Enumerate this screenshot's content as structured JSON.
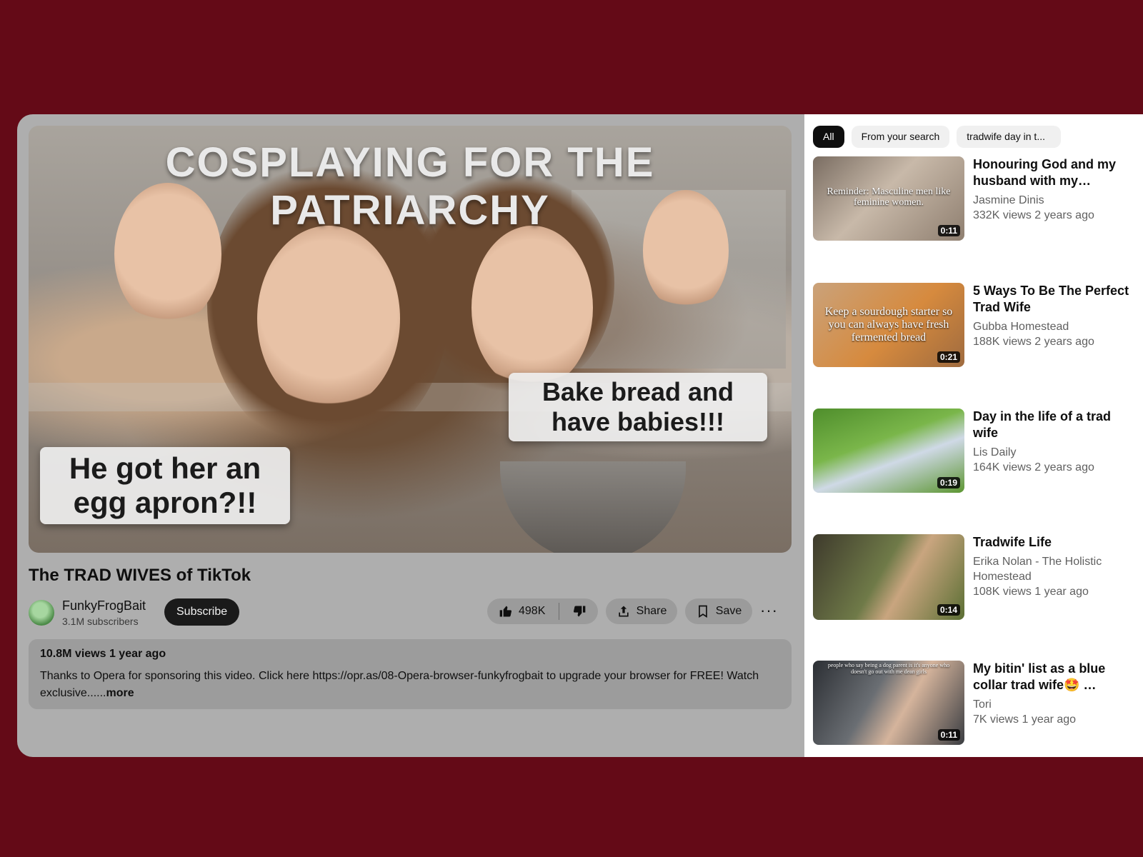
{
  "player": {
    "thumbnail_title": "COSPLAYING FOR THE PATRIARCHY",
    "caption_left": "He got her an egg apron?!!",
    "caption_right": "Bake bread and have babies!!!"
  },
  "video": {
    "title": "The TRAD WIVES of TikTok",
    "channel": "FunkyFrogBait",
    "subscribers": "3.1M subscribers",
    "subscribe_label": "Subscribe",
    "likes": "498K",
    "share_label": "Share",
    "save_label": "Save",
    "more_label": "···"
  },
  "description": {
    "stats": "10.8M views 1 year ago",
    "text": "Thanks to Opera for sponsoring this video. Click here https://opr.as/08-Opera-browser-funkyfrogbait to upgrade your browser for FREE! Watch exclusive......",
    "more_label": "more"
  },
  "chips": [
    "All",
    "From your search",
    "tradwife day in t..."
  ],
  "recommendations": [
    {
      "title": "Honouring God and my husband with my…",
      "author": "Jasmine Dinis",
      "meta": "332K views 2 years ago",
      "duration": "0:11",
      "overlay": "Reminder: Masculine men like feminine women."
    },
    {
      "title": "5 Ways To Be The Perfect Trad Wife",
      "author": "Gubba Homestead",
      "meta": "188K views 2 years ago",
      "duration": "0:21",
      "overlay": "Keep a sourdough starter so you can always have fresh fermented bread"
    },
    {
      "title": "Day in the life of a trad wife",
      "author": "Lis Daily",
      "meta": "164K views 2 years ago",
      "duration": "0:19",
      "overlay": ""
    },
    {
      "title": "Tradwife Life",
      "author": "Erika Nolan - The Holistic Homestead",
      "meta": "108K views 1 year ago",
      "duration": "0:14",
      "overlay": ""
    },
    {
      "title": "My bitin' list as a blue collar trad wife🤩 …",
      "author": "Tori",
      "meta": "7K views 1 year ago",
      "duration": "0:11",
      "overlay": "people who say being a dog parent is it's anyone who doesn't go out with me dean girls"
    }
  ]
}
